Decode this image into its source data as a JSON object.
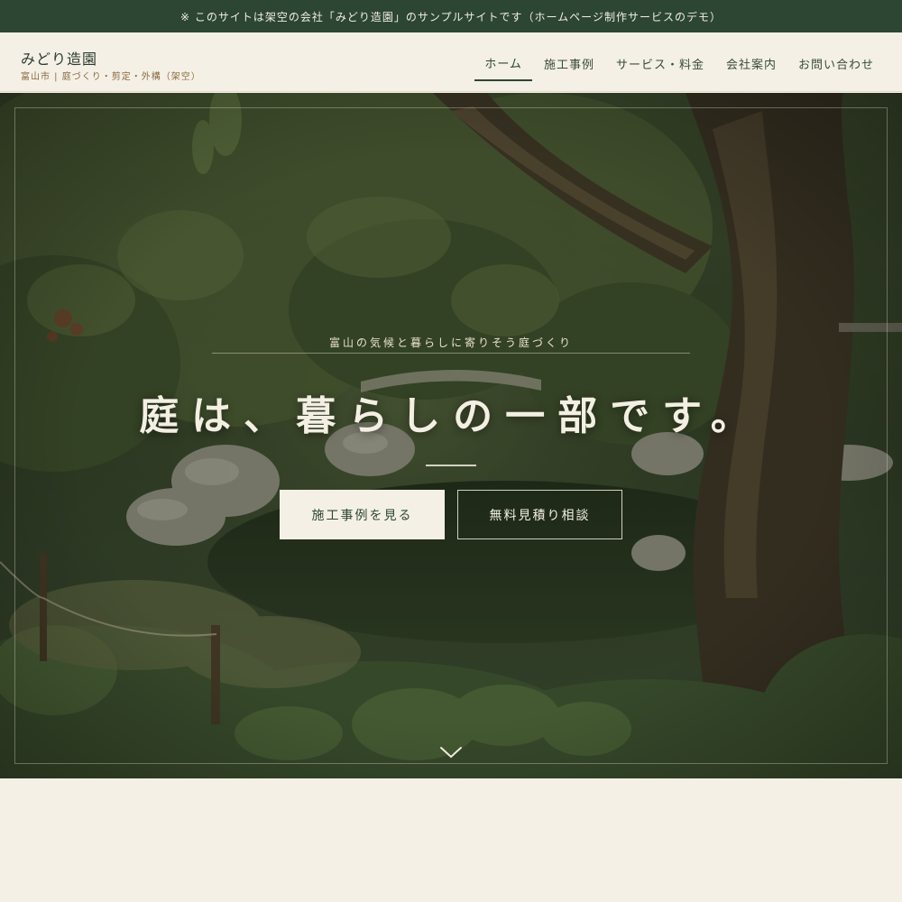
{
  "announcement": "※ このサイトは架空の会社「みどり造園」のサンプルサイトです（ホームページ制作サービスのデモ）",
  "brand": {
    "name": "みどり造園",
    "tagline": "富山市 | 庭づくり・剪定・外構（架空）"
  },
  "nav": {
    "items": [
      {
        "label": "ホーム",
        "active": true
      },
      {
        "label": "施工事例",
        "active": false
      },
      {
        "label": "サービス・料金",
        "active": false
      },
      {
        "label": "会社案内",
        "active": false
      },
      {
        "label": "お問い合わせ",
        "active": false
      }
    ]
  },
  "hero": {
    "tagline": "富山の気候と暮らしに寄りそう庭づくり",
    "title": "庭は、暮らしの一部です。",
    "primary_button": "施工事例を見る",
    "secondary_button": "無料見積り相談",
    "scroll_icon": "chevron-down-icon"
  },
  "colors": {
    "announcement_bg": "#2d4634",
    "page_bg": "#f4f0e6",
    "brand_text": "#2b3a2e",
    "tagline_text": "#8a6a3e"
  }
}
